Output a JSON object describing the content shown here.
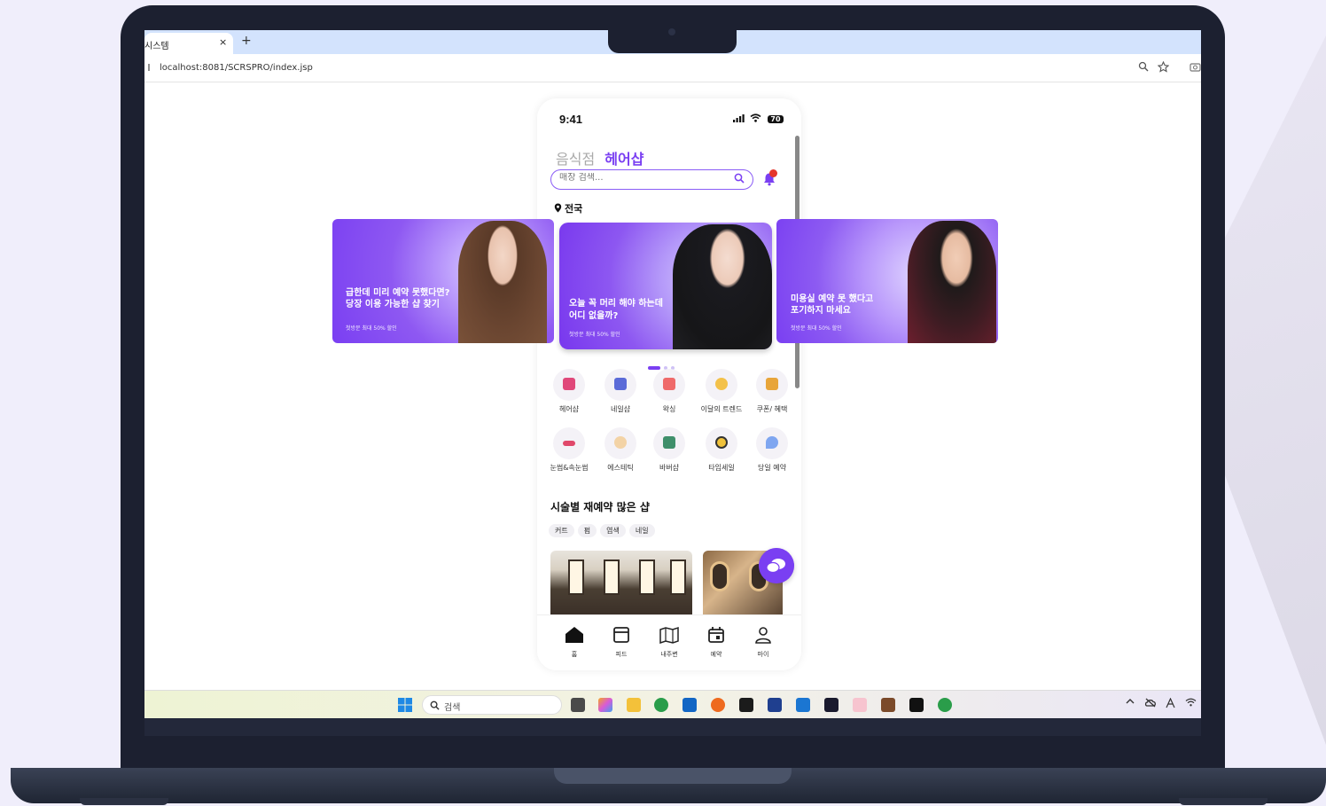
{
  "browser": {
    "tab_title": "시스템",
    "tab_close": "×",
    "new_tab": "+",
    "url": "localhost:8081/SCRSPRO/index.jsp",
    "info_icon": "info-icon"
  },
  "phone": {
    "status_time": "9:41",
    "battery": "70",
    "category_tabs": [
      "음식점",
      "헤어샵"
    ],
    "active_category": "헤어샵",
    "search_placeholder": "매장 검색...",
    "location": "전국",
    "banners": [
      {
        "title_line1": "급한데 미리 예약 못했다면?",
        "title_line2": "당장 이용 가능한 샵 찾기",
        "sub": "첫방문 최대 50% 할인"
      },
      {
        "title_line1": "오늘 꼭 머리 해야 하는데",
        "title_line2": "어디 없을까?",
        "sub": "첫방문 최대 50% 할인"
      },
      {
        "title_line1": "미용실 예약 못 했다고",
        "title_line2": "포기하지 마세요",
        "sub": "첫방문 최대 50% 할인"
      }
    ],
    "quick_menu_row1": [
      "헤어샵",
      "네일샵",
      "왁싱",
      "이달의 트렌드",
      "쿠폰/ 혜택"
    ],
    "quick_menu_row2": [
      "눈썹&속눈썹",
      "에스테틱",
      "바버샵",
      "타임세일",
      "당일 예약"
    ],
    "section_title": "시술별 재예약 많은 샵",
    "chips": [
      "커트",
      "펌",
      "염색",
      "네일"
    ],
    "bottom_nav": [
      "홈",
      "피드",
      "내주변",
      "예약",
      "마이"
    ]
  },
  "taskbar": {
    "search_label": "검색"
  },
  "colors": {
    "accent": "#7a3ff2",
    "badge": "#e5352b"
  }
}
